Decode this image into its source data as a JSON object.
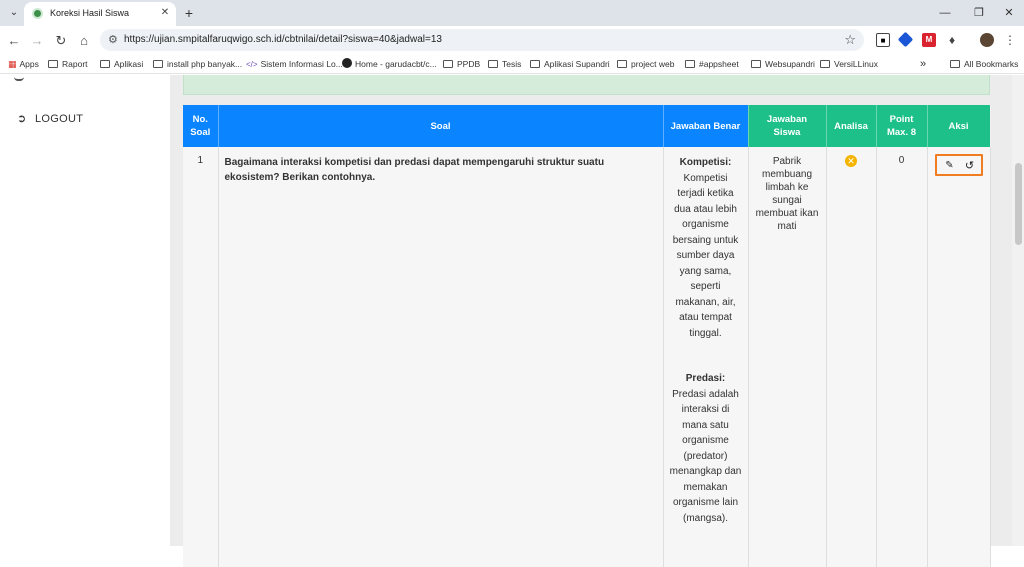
{
  "browser": {
    "tab_title": "Koreksi Hasil Siswa",
    "url": "https://ujian.smpitalfaruqwigo.sch.id/cbtnilai/detail?siswa=40&jadwal=13",
    "bookmarks": [
      "Apps",
      "Raport",
      "Aplikasi",
      "install php banyak...",
      "Sistem Informasi Lo...",
      "Home - garudacbt/c...",
      "PPDB",
      "Tesis",
      "Aplikasi Supandri",
      "project web",
      "#appsheet",
      "Websupandri",
      "VersiLLinux",
      "All Bookmarks"
    ]
  },
  "sidebar": {
    "logout_label": "LOGOUT"
  },
  "table": {
    "headers": {
      "no": "No. Soal",
      "soal": "Soal",
      "jawaban_benar": "Jawaban Benar",
      "jawaban_siswa": "Jawaban Siswa",
      "analisa": "Analisa",
      "point": "Point Max. 8",
      "aksi": "Aksi"
    },
    "rows": [
      {
        "no": "1",
        "soal": "Bagaimana interaksi kompetisi dan predasi dapat mempengaruhi struktur suatu ekosistem? Berikan contohnya.",
        "kunci_label_1": "Kompetisi:",
        "kunci_text_1": "Kompetisi terjadi ketika dua atau lebih organisme bersaing untuk sumber daya yang sama, seperti makanan, air, atau tempat tinggal.",
        "kunci_label_2": "Predasi:",
        "kunci_text_2": "Predasi adalah interaksi di mana satu organisme (predator) menangkap dan memakan organisme lain (mangsa).",
        "jawaban_siswa": "Pabrik membuang limbah ke sungai membuat ikan mati",
        "analisa_icon": "x-circle-icon",
        "point": "0"
      }
    ]
  },
  "colors": {
    "header_blue": "#0a84ff",
    "header_green": "#1ec08a",
    "highlight_orange": "#f07d22",
    "wrong_badge": "#f4b400"
  }
}
